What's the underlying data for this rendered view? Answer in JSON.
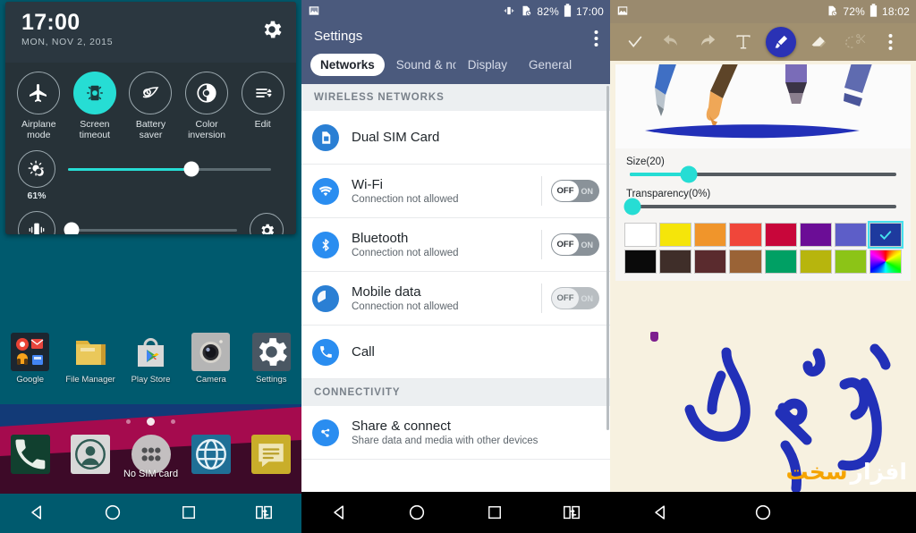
{
  "panel1": {
    "quick_settings": {
      "time": "17:00",
      "date": "MON, NOV 2, 2015",
      "gear_icon": "gear-icon",
      "toggles": [
        {
          "label": "Airplane\nmode",
          "label_l1": "Airplane",
          "label_l2": "mode",
          "icon": "airplane-icon",
          "active": false
        },
        {
          "label": "Screen timeout",
          "label_l1": "Screen",
          "label_l2": "timeout",
          "icon": "screen-timeout-icon",
          "active": true
        },
        {
          "label": "Battery saver",
          "label_l1": "Battery",
          "label_l2": "saver",
          "icon": "battery-saver-icon",
          "active": false
        },
        {
          "label": "Color inversion",
          "label_l1": "Color",
          "label_l2": "inversion",
          "icon": "color-inversion-icon",
          "active": false
        },
        {
          "label": "Edit",
          "label_l1": "Edit",
          "label_l2": "",
          "icon": "edit-icon",
          "active": false
        }
      ],
      "brightness": {
        "icon": "brightness-icon",
        "value": "61%",
        "percent": 61,
        "fill_color": "#26ddd4"
      },
      "volume": {
        "icon": "vibrate-icon",
        "percent": 0,
        "settings_icon": "gear-icon"
      }
    },
    "home": {
      "apps": [
        {
          "label": "Google",
          "icon": "google-folder-icon"
        },
        {
          "label": "File Manager",
          "icon": "file-manager-icon"
        },
        {
          "label": "Play Store",
          "icon": "play-store-icon"
        },
        {
          "label": "Camera",
          "icon": "camera-icon"
        },
        {
          "label": "Settings",
          "icon": "settings-gear-icon"
        }
      ],
      "page_dots": 3,
      "active_dot": 1,
      "dock": [
        {
          "icon": "phone-icon",
          "label": ""
        },
        {
          "icon": "contacts-icon",
          "label": ""
        },
        {
          "icon": "app-drawer-icon",
          "label": "No SIM card"
        },
        {
          "icon": "browser-globe-icon",
          "label": ""
        },
        {
          "icon": "messaging-icon",
          "label": ""
        }
      ],
      "wallpaper_colors": {
        "teal": "#005a6e",
        "blue": "#123a77",
        "pink": "#a50b4e",
        "dark": "#3d0a28"
      }
    },
    "navbar": [
      {
        "icon": "back-icon"
      },
      {
        "icon": "home-icon"
      },
      {
        "icon": "recents-icon"
      },
      {
        "icon": "dual-window-icon"
      }
    ]
  },
  "panel2": {
    "statusbar": {
      "left_icon": "image-icon",
      "icons": [
        "vibrate-icon",
        "no-sim-icon"
      ],
      "battery": "82%",
      "battery_icon": "battery-icon",
      "time": "17:00",
      "bg_color": "#4b5a7d"
    },
    "appbar": {
      "title": "Settings",
      "overflow_icon": "overflow-menu-icon"
    },
    "tabs": [
      {
        "label": "Networks",
        "active": true
      },
      {
        "label": "Sound & no",
        "active": false
      },
      {
        "label": "Display",
        "active": false
      },
      {
        "label": "General",
        "active": false
      }
    ],
    "sections": [
      {
        "header": "WIRELESS NETWORKS",
        "rows": [
          {
            "title": "Dual SIM Card",
            "subtitle": "",
            "icon": "sim-card-icon",
            "icon_color": "#2a7fd4",
            "toggle": null
          },
          {
            "title": "Wi-Fi",
            "subtitle": "Connection not allowed",
            "icon": "wifi-icon",
            "icon_color": "#2a8df0",
            "toggle": {
              "state": "OFF",
              "off_label": "OFF",
              "on_label": "ON",
              "disabled": false
            }
          },
          {
            "title": "Bluetooth",
            "subtitle": "Connection not allowed",
            "icon": "bluetooth-icon",
            "icon_color": "#2a8df0",
            "toggle": {
              "state": "OFF",
              "off_label": "OFF",
              "on_label": "ON",
              "disabled": false
            }
          },
          {
            "title": "Mobile data",
            "subtitle": "Connection not allowed",
            "icon": "mobile-data-icon",
            "icon_color": "#2a7fd4",
            "toggle": {
              "state": "OFF",
              "off_label": "OFF",
              "on_label": "ON",
              "disabled": true
            }
          },
          {
            "title": "Call",
            "subtitle": "",
            "icon": "call-icon",
            "icon_color": "#2a8df0",
            "toggle": null
          }
        ]
      },
      {
        "header": "CONNECTIVITY",
        "rows": [
          {
            "title": "Share & connect",
            "subtitle": "Share data and media with other devices",
            "icon": "share-connect-icon",
            "icon_color": "#2a8df0",
            "toggle": null
          }
        ]
      }
    ],
    "navbar": [
      {
        "icon": "back-icon"
      },
      {
        "icon": "home-icon"
      },
      {
        "icon": "recents-icon"
      },
      {
        "icon": "dual-window-icon"
      }
    ]
  },
  "panel3": {
    "statusbar": {
      "left_icon": "image-icon",
      "icons": [
        "no-sim-icon"
      ],
      "battery": "72%",
      "battery_icon": "battery-icon",
      "time": "18:02",
      "bg_color": "#9a8a6e"
    },
    "toolbar": {
      "bg_color": "#a1906f",
      "tools": [
        {
          "name": "confirm-check-icon",
          "active": false
        },
        {
          "name": "undo-icon",
          "active": false
        },
        {
          "name": "redo-icon",
          "active": false
        },
        {
          "name": "text-tool-icon",
          "active": false
        },
        {
          "name": "brush-tool-icon",
          "active": true
        },
        {
          "name": "eraser-tool-icon",
          "active": false
        },
        {
          "name": "lasso-cut-icon",
          "active": false
        },
        {
          "name": "overflow-menu-icon",
          "active": false
        }
      ],
      "active_color": "#2a32b5"
    },
    "preview": {
      "stroke_color": "#2230b8",
      "pens": [
        "pencil-pen",
        "paint-brush",
        "marker-pen",
        "highlighter-pen"
      ]
    },
    "sliders": [
      {
        "label": "Size(20)",
        "percent": 22,
        "fill_color": "#26ddd4"
      },
      {
        "label": "Transparency(0%)",
        "percent": 0,
        "fill_color": "#26ddd4"
      }
    ],
    "palette": {
      "row1": [
        "#ffffff",
        "#f5e50a",
        "#f0952b",
        "#f0463a",
        "#c8063a",
        "#6b0d96",
        "#5d5ec8",
        "#1e3a9e"
      ],
      "row2": [
        "#0a0a0a",
        "#3f2e29",
        "#5a2b2e",
        "#9a6336",
        "#00a064",
        "#b7b50d",
        "#8cc417",
        "rainbow"
      ],
      "selected_row": 1,
      "selected_index": 7,
      "check_icon": "check-icon",
      "selected_outline": "#45e0ee"
    },
    "canvas": {
      "bg_color": "#f7f1e0",
      "ink_color": "#2230b8",
      "artifact": "purple-dot"
    },
    "watermark": {
      "text_white": "افزار",
      "text_yellow": "سخت",
      "color_white": "#ffffff",
      "color_yellow": "#f5a400"
    },
    "navbar": [
      {
        "icon": "back-icon"
      },
      {
        "icon": "home-icon"
      },
      {
        "icon": "recents-icon"
      }
    ]
  }
}
